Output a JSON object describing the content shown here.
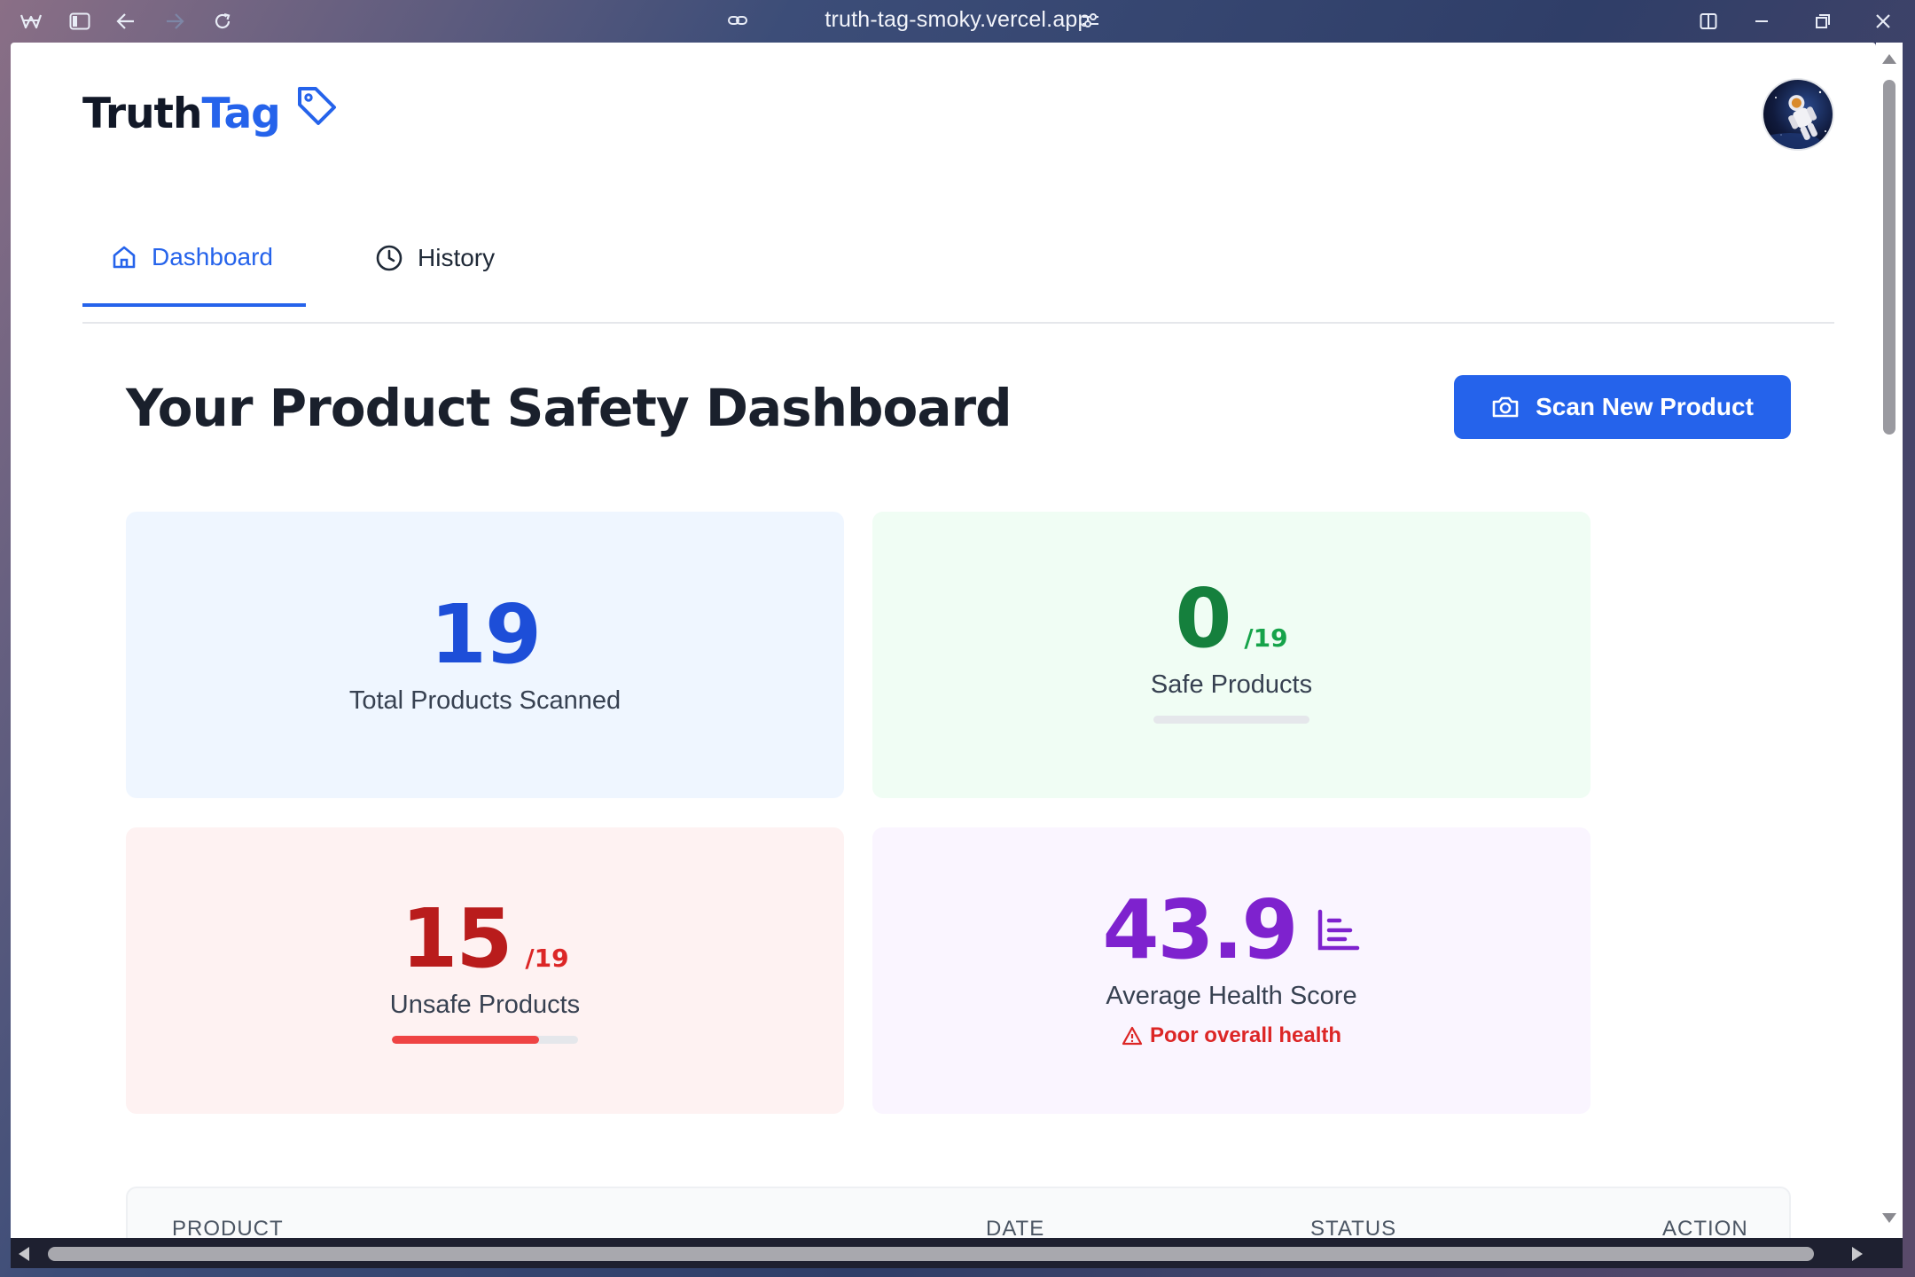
{
  "browser": {
    "url": "truth-tag-smoky.vercel.app",
    "icons": [
      "browser-logo-icon",
      "sidebar-toggle-icon",
      "back-icon",
      "forward-icon",
      "reload-icon",
      "link-icon",
      "site-settings-icon",
      "split-view-icon",
      "minimize-icon",
      "restore-icon",
      "close-icon"
    ]
  },
  "brand": {
    "part1": "Truth",
    "part2": "Tag",
    "icon": "tag-icon"
  },
  "user": {
    "avatar_icon": "astronaut-avatar"
  },
  "tabs": [
    {
      "label": "Dashboard",
      "icon": "home-icon",
      "active": true
    },
    {
      "label": "History",
      "icon": "clock-icon",
      "active": false
    }
  ],
  "page": {
    "title": "Your Product Safety Dashboard"
  },
  "actions": {
    "scan_label": "Scan New Product",
    "scan_icon": "camera-icon"
  },
  "stats": {
    "total": {
      "value": "19",
      "label": "Total Products Scanned",
      "color": "#1d4ed8"
    },
    "safe": {
      "value": "0",
      "denominator": "/19",
      "label": "Safe Products",
      "progress": 0,
      "color": "#15803d",
      "denom_color": "#16a34a"
    },
    "unsafe": {
      "value": "15",
      "denominator": "/19",
      "label": "Unsafe Products",
      "progress": 0.789,
      "color": "#b91c1c",
      "denom_color": "#dc2626",
      "bar_color": "#ef4444"
    },
    "health": {
      "value": "43.9",
      "label": "Average Health Score",
      "warning": "Poor overall health",
      "icon": "bar-chart-icon",
      "color": "#7e22ce"
    }
  },
  "table": {
    "columns": [
      "PRODUCT",
      "DATE",
      "STATUS",
      "ACTION"
    ]
  }
}
